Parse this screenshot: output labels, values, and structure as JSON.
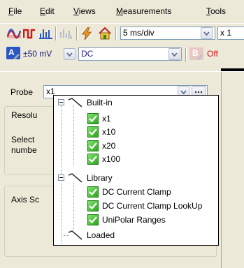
{
  "menu": [
    {
      "label": "File",
      "mn": "F",
      "rest": "ile"
    },
    {
      "label": "Edit",
      "mn": "E",
      "rest": "dit"
    },
    {
      "label": "Views",
      "mn": "V",
      "rest": "iews"
    },
    {
      "label": "Measurements",
      "mn": "M",
      "rest": "easurements"
    },
    {
      "label": "Tools",
      "mn": "T",
      "rest": "ools"
    }
  ],
  "toolbar1": {
    "timebase": "5 ms/div",
    "samples": "x 1"
  },
  "toolbar2": {
    "channel_label": "A",
    "range": "±50 mV",
    "coupling": "DC",
    "channel_b_label": "B",
    "channel_b_state": "Off"
  },
  "panel": {
    "probe_label": "Probe",
    "probe_value": "x1",
    "resolution_title": "Resolu",
    "resolution_text_1": "Select",
    "resolution_text_2": "numbe",
    "axis_title": "Axis Sc"
  },
  "tree": {
    "builtin": "Built-in",
    "builtin_items": [
      "x1",
      "x10",
      "x20",
      "x100"
    ],
    "library": "Library",
    "library_items": [
      "DC Current Clamp",
      "DC Current Clamp LookUp",
      "UniPolar Ranges"
    ],
    "loaded": "Loaded"
  },
  "colors": {
    "accent_red": "#d4141c",
    "scope_blue": "#2a56c6",
    "check_green": "#3cb52a"
  }
}
